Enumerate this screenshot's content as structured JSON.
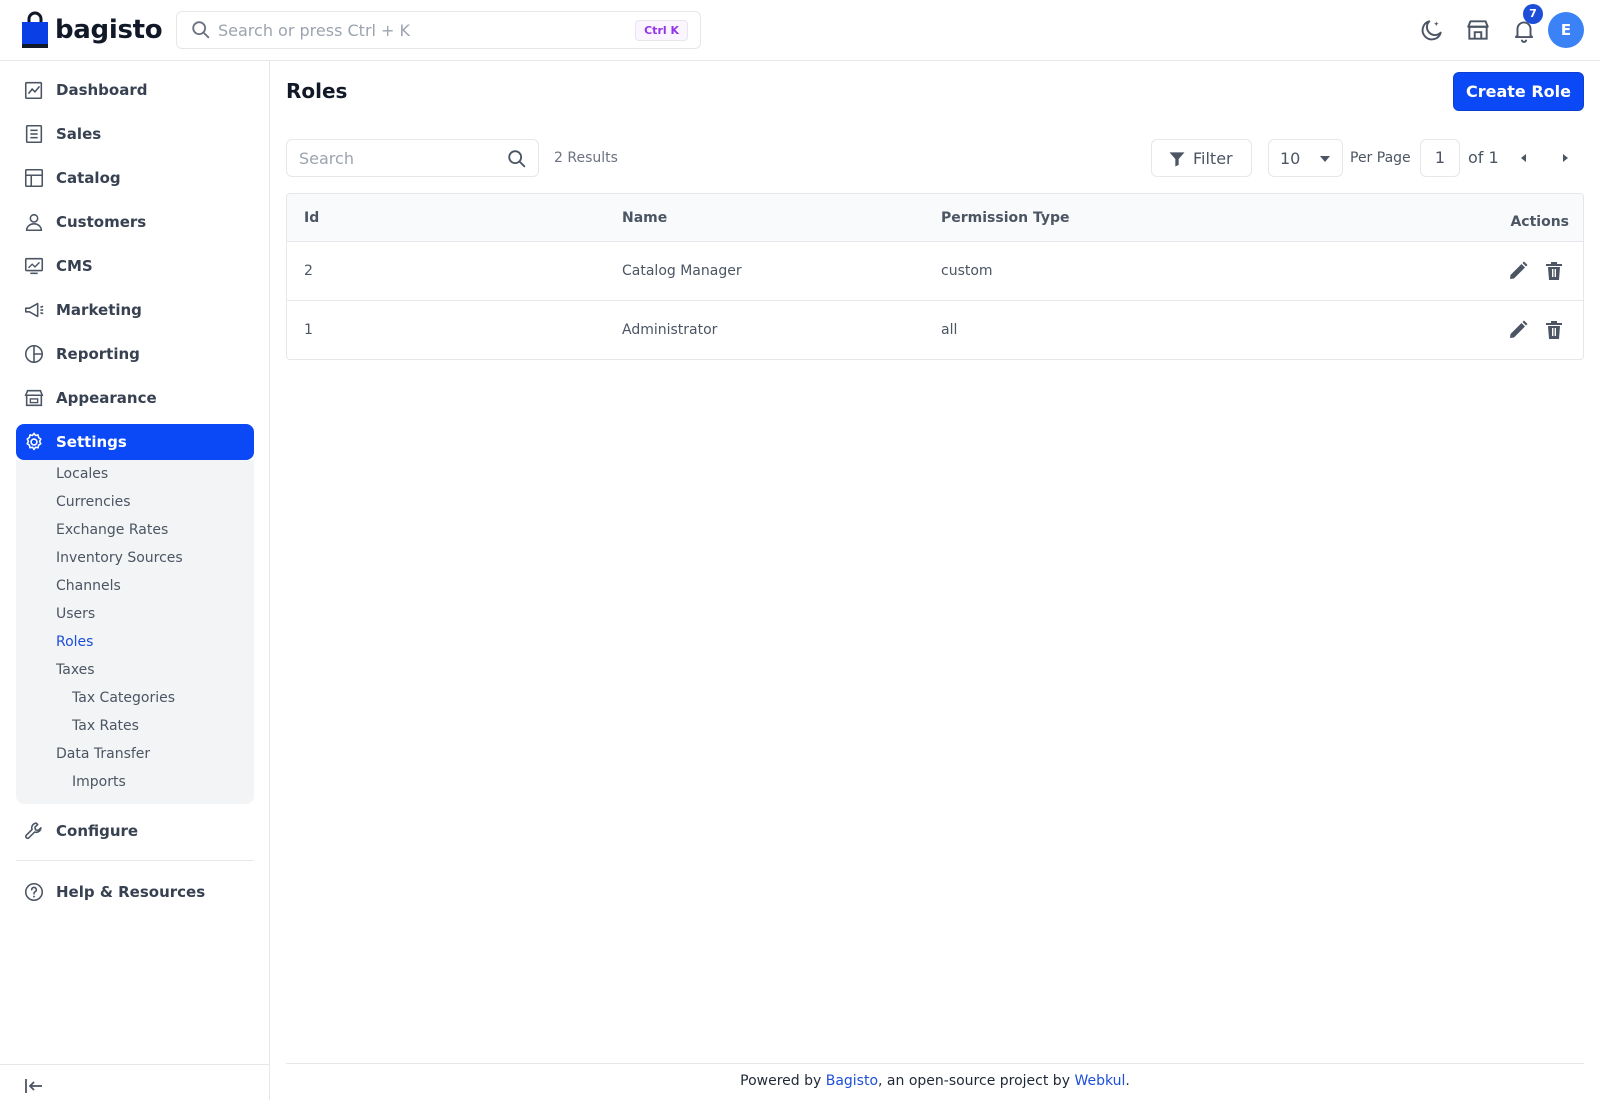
{
  "header": {
    "brand": "bagisto",
    "search_placeholder": "Search or press Ctrl + K",
    "search_shortcut": "Ctrl K",
    "notification_count": "7",
    "avatar_initial": "E"
  },
  "sidebar": {
    "items": [
      {
        "label": "Dashboard"
      },
      {
        "label": "Sales"
      },
      {
        "label": "Catalog"
      },
      {
        "label": "Customers"
      },
      {
        "label": "CMS"
      },
      {
        "label": "Marketing"
      },
      {
        "label": "Reporting"
      },
      {
        "label": "Appearance"
      },
      {
        "label": "Settings"
      },
      {
        "label": "Configure"
      },
      {
        "label": "Help & Resources"
      }
    ],
    "settings_submenu": [
      {
        "label": "Locales"
      },
      {
        "label": "Currencies"
      },
      {
        "label": "Exchange Rates"
      },
      {
        "label": "Inventory Sources"
      },
      {
        "label": "Channels"
      },
      {
        "label": "Users"
      },
      {
        "label": "Roles"
      },
      {
        "label": "Taxes"
      },
      {
        "label": "Tax Categories"
      },
      {
        "label": "Tax Rates"
      },
      {
        "label": "Data Transfer"
      },
      {
        "label": "Imports"
      }
    ],
    "active_item": "Settings",
    "active_subitem": "Roles"
  },
  "main": {
    "title": "Roles",
    "create_button": "Create Role",
    "search_placeholder": "Search",
    "results_count": "2 Results",
    "filter_label": "Filter",
    "per_page_value": "10",
    "per_page_label": "Per Page",
    "current_page": "1",
    "page_of": "of 1",
    "table": {
      "columns": [
        "Id",
        "Name",
        "Permission Type",
        "Actions"
      ],
      "rows": [
        {
          "id": "2",
          "name": "Catalog Manager",
          "permission_type": "custom"
        },
        {
          "id": "1",
          "name": "Administrator",
          "permission_type": "all"
        }
      ]
    }
  },
  "footer": {
    "prefix": "Powered by ",
    "link1": "Bagisto",
    "middle": ", an open-source project by ",
    "link2": "Webkul",
    "suffix": "."
  },
  "colors": {
    "accent": "#0a49f5",
    "link": "#1d4ed8"
  }
}
